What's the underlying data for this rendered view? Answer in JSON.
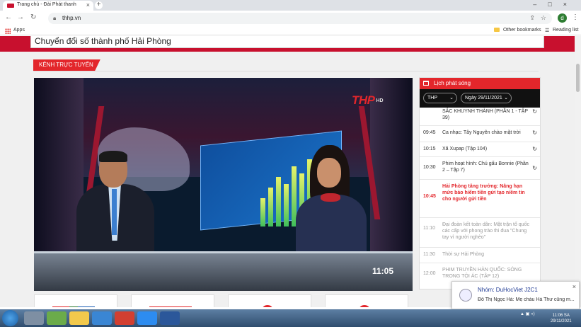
{
  "browser": {
    "tab_title": "Trang chủ - Đài Phát thanh",
    "url": "thhp.vn",
    "bookmarks": {
      "apps": "Apps",
      "other": "Other bookmarks",
      "reading": "Reading list"
    },
    "profile_initial": "d"
  },
  "page": {
    "header_text": "Chuyển đổi số thành phố Hải Phòng",
    "section_title": "KÊNH TRỰC TUYẾN",
    "player": {
      "logo": "THP",
      "logo_suffix": "HD",
      "clock": "11:05"
    },
    "schedule": {
      "title": "Lịch phát sóng",
      "channel": "THP",
      "date": "Ngày 29/11/2021",
      "items": [
        {
          "time": "",
          "program": "SẮC KHUYNH THÀNH (PHẦN 1 - TẬP 39)",
          "status": "replay"
        },
        {
          "time": "09:45",
          "program": "Ca nhạc: Tây Nguyên chào mặt trời",
          "status": "replay"
        },
        {
          "time": "10:15",
          "program": "Xã Xupap (Tập 104)",
          "status": "replay"
        },
        {
          "time": "10:30",
          "program": "Phim hoạt hình: Chú gấu Bonnie (Phần 2 – Tập 7)",
          "status": "replay"
        },
        {
          "time": "10:45",
          "program": "Hải Phòng tăng trưởng: Nâng hạn mức bảo hiểm tiền gửi tạo niềm tin cho người gửi tiền",
          "status": "live"
        },
        {
          "time": "11:10",
          "program": "Đại đoàn kết toàn dân: Mặt trận tổ quốc các cấp với phong trào thi đua \"Chung tay vì người nghèo\"",
          "status": "upcoming"
        },
        {
          "time": "11:30",
          "program": "Thời sự Hải Phòng",
          "status": "upcoming"
        },
        {
          "time": "12:00",
          "program": "PHIM TRUYỀN HÀN QUỐC: SÓNG TRONG TỘI ÁC (TẬP 12)",
          "status": "upcoming"
        }
      ]
    }
  },
  "notification": {
    "title": "Nhóm: DuHocViet J2C1",
    "body": "Đỗ Thị Ngọc Hà: Mẹ cháu Hà Thư cũng m..."
  },
  "taskbar": {
    "time": "11:06 SA",
    "date": "29/11/2021"
  },
  "colors": {
    "brand_red": "#e3262b",
    "header_red": "#c8102e",
    "live_text": "#e3262b"
  }
}
